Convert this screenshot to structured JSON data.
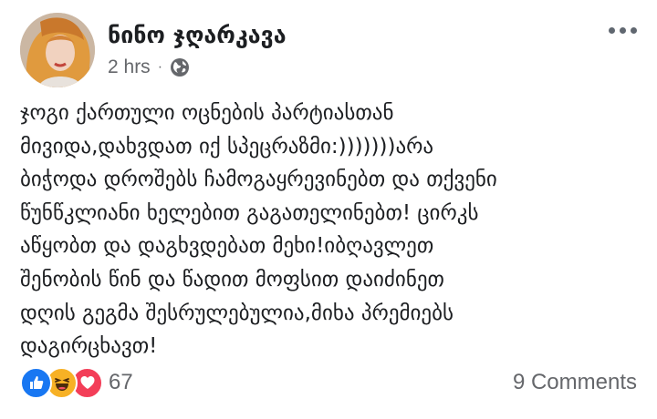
{
  "post": {
    "author": "ნინო ჯღარკავა",
    "time": "2 hrs",
    "separator": "·",
    "audience_icon": "globe-icon",
    "lines": [
      "ჯოგი ქართული ოცნების პარტიასთან",
      "მივიდა,დახვდათ იქ სპეცრაზმი:)))))))არა",
      "ბიჭოდა დროშებს ჩამოგაყრევინებთ და თქვენი",
      "წუნწკლიანი ხელებით გაგათელინებთ! ცირკს",
      "აწყობთ და დაგხვდებათ მეხი!იბღავლეთ",
      "შენობის წინ  და წადით მოფსით დაიძინეთ",
      "დღის გეგმა შესრულებულია,მიხა პრემიებს",
      "დაგირცხავთ!"
    ]
  },
  "reactions": {
    "icons": [
      "like-icon",
      "haha-icon",
      "love-icon"
    ],
    "count": "67"
  },
  "comments_label": "9 Comments",
  "colors": {
    "text": "#1c1e21",
    "meta": "#65676b",
    "like": "#1877f2",
    "haha": "#f7b125",
    "love": "#f33e58"
  }
}
